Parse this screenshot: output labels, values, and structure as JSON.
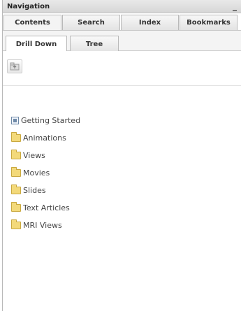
{
  "panel": {
    "title": "Navigation",
    "minimize_label": "_"
  },
  "tabs": [
    {
      "label": "Contents",
      "active": true
    },
    {
      "label": "Search",
      "active": false
    },
    {
      "label": "Index",
      "active": false
    },
    {
      "label": "Bookmarks",
      "active": false
    }
  ],
  "subtabs": [
    {
      "label": "Drill Down",
      "active": true
    },
    {
      "label": "Tree",
      "active": false
    }
  ],
  "toolbar": {
    "up_icon": "folder-up-icon"
  },
  "tree": [
    {
      "label": "Getting Started",
      "icon": "document-icon"
    },
    {
      "label": "Animations",
      "icon": "folder-icon"
    },
    {
      "label": "Views",
      "icon": "folder-icon"
    },
    {
      "label": "Movies",
      "icon": "folder-icon"
    },
    {
      "label": "Slides",
      "icon": "folder-icon"
    },
    {
      "label": "Text Articles",
      "icon": "folder-icon"
    },
    {
      "label": "MRI Views",
      "icon": "folder-icon"
    }
  ]
}
